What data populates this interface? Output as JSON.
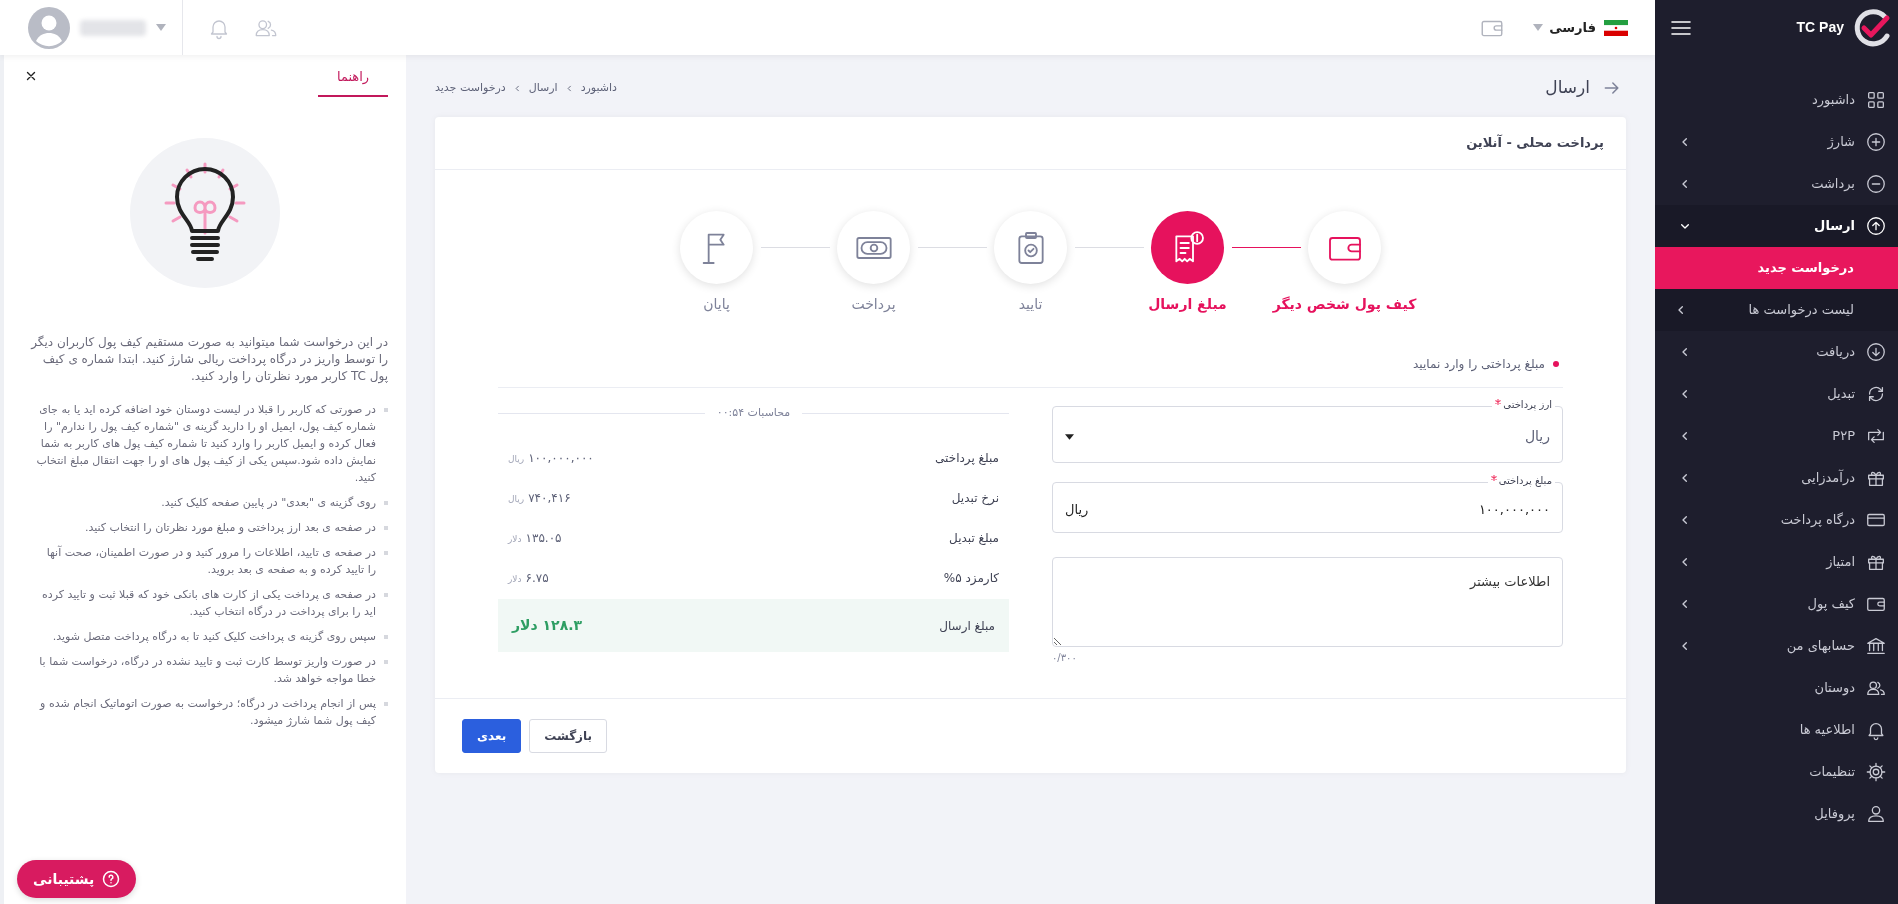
{
  "sidebar": {
    "brand": "TC Pay",
    "items": [
      {
        "label": "داشبورد"
      },
      {
        "label": "شارژ",
        "expanded": false
      },
      {
        "label": "برداشت",
        "expanded": false
      },
      {
        "label": "ارسال",
        "expanded": true,
        "children": [
          {
            "label": "درخواست جدید",
            "selected": true
          },
          {
            "label": "لیست درخواست ها",
            "selected": false,
            "expanded": false
          }
        ]
      },
      {
        "label": "دریافت",
        "expanded": false
      },
      {
        "label": "تبدیل",
        "expanded": false
      },
      {
        "label": "P۲P",
        "expanded": false
      },
      {
        "label": "درآمدزایی",
        "expanded": false
      },
      {
        "label": "درگاه پرداخت",
        "expanded": false
      },
      {
        "label": "امتیاز",
        "expanded": false
      },
      {
        "label": "کیف پول",
        "expanded": false
      },
      {
        "label": "حسابهای من",
        "expanded": false
      },
      {
        "label": "دوستان"
      },
      {
        "label": "اطلاعیه ها"
      },
      {
        "label": "تنظیمات"
      },
      {
        "label": "پروفایل"
      }
    ]
  },
  "top_bar": {
    "language": "فارسی"
  },
  "page": {
    "title": "ارسال",
    "breadcrumb": [
      "داشبورد",
      "ارسال",
      "درخواست جدید"
    ]
  },
  "card": {
    "title": "پرداخت محلی - آنلاین",
    "steps": [
      {
        "label": "کیف پول شخص دیگر",
        "completed": true,
        "selected": false
      },
      {
        "label": "مبلغ ارسال",
        "completed": false,
        "selected": true
      },
      {
        "label": "تایید",
        "completed": false,
        "selected": false
      },
      {
        "label": "پرداخت",
        "completed": false,
        "selected": false
      },
      {
        "label": "پایان",
        "completed": false,
        "selected": false
      }
    ],
    "section_label": "مبلغ پرداختی را وارد نمایید",
    "form": {
      "currency": {
        "label": "ارز پرداختی",
        "required": true,
        "value": "ریال"
      },
      "amount": {
        "label": "مبلغ پرداختی",
        "required": true,
        "value": "۱۰۰,۰۰۰,۰۰۰",
        "unit": "ریال"
      },
      "notes": {
        "placeholder": "اطلاعات بیشتر",
        "counter": "۰/۳۰۰"
      }
    },
    "summary": {
      "title": "محاسبات ۰۰:۵۴",
      "rows": [
        {
          "label": "مبلغ پرداختی",
          "value": "۱۰۰,۰۰۰,۰۰۰",
          "unit": "ریال"
        },
        {
          "label": "نرخ تبدیل",
          "value": "۷۴۰,۴۱۶",
          "unit": "ریال"
        },
        {
          "label": "مبلغ تبدیل",
          "value": "۱۳۵.۰۵",
          "unit": "دلار"
        },
        {
          "label": "کارمزد ۵%",
          "value": "۶.۷۵",
          "unit": "دلار"
        }
      ],
      "total": {
        "label": "مبلغ ارسال",
        "value": "۱۲۸.۳ دلار"
      }
    },
    "buttons": [
      {
        "label": "بازگشت",
        "kind": "secondary"
      },
      {
        "label": "بعدی",
        "kind": "primary"
      }
    ]
  },
  "help": {
    "tabs": [
      {
        "label": "راهنما",
        "selected": true
      }
    ],
    "intro": "در این درخواست شما میتوانید به صورت مستقیم کیف پول کاربران دیگر را توسط واریز در درگاه پرداخت ریالی شارژ کنید. ابتدا شماره ی کیف پول TC کاربر مورد نظرتان را وارد کنید.",
    "steps": [
      "در صورتی که کاربر را قبلا در لیست دوستان خود اضافه کرده اید یا به جای شماره کیف پول، ایمیل او را دارید گزینه ی \"شماره کیف پول را ندارم\" را فعال کرده و ایمیل کاربر را وارد کنید تا شماره کیف پول های کاربر به شما نمایش داده شود.سپس یکی از کیف پول های او را جهت انتقال مبلغ انتخاب کنید.",
      "روی گزینه ی \"بعدی\" در پایین صفحه کلیک کنید.",
      "در صفحه ی بعد ارز پرداختی و مبلغ مورد نظرتان را انتخاب کنید.",
      "در صفحه ی تایید، اطلاعات را مرور کنید و در صورت اطمینان، صحت آنها را تایید کرده و به صفحه ی بعد بروید.",
      "در صفحه ی پرداخت یکی از کارت های بانکی خود که قبلا ثبت و تایید کرده اید را برای پرداخت در درگاه انتخاب کنید.",
      "سپس روی گزینه ی پرداخت کلیک کنید تا به درگاه پرداخت متصل شوید.",
      "در صورت واریز توسط کارت ثبت و تایید نشده در درگاه، درخواست شما با خطا مواجه خواهد شد.",
      "پس از انجام پرداخت در درگاه؛ درخواست به صورت اتوماتیک انجام شده و کیف پول شما شارژ میشود."
    ],
    "support_button": "پشتیبانی"
  }
}
